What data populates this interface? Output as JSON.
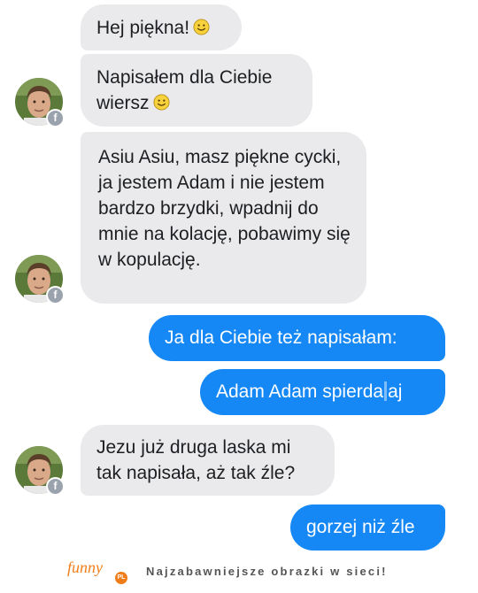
{
  "messages": [
    {
      "side": "in",
      "text": "Hej piękna!",
      "emoji": "smiley-emoji"
    },
    {
      "side": "in",
      "text": "Napisałem dla Ciebie wiersz",
      "emoji": "smiley-emoji"
    },
    {
      "side": "in",
      "text": "Asiu Asiu, masz piękne cycki, ja jestem Adam i nie jestem bardzo brzydki, wpadnij do mnie na kolację, pobawimy się w kopulację."
    },
    {
      "side": "out",
      "text": "Ja dla Ciebie też napisałam:"
    },
    {
      "side": "out",
      "text_before_cursor": "Adam Adam spierda",
      "text_after_cursor": "aj"
    },
    {
      "side": "in",
      "text": "Jezu już druga laska mi tak napisała, aż tak źle?"
    },
    {
      "side": "out",
      "text": "gorzej niż źle"
    }
  ],
  "avatar": {
    "icon": "profile-photo",
    "badge_icon": "facebook-icon",
    "badge_text": "f"
  },
  "colors": {
    "incoming_bubble": "#eaeaec",
    "outgoing_bubble": "#1688f5",
    "brand": "#f07d1a"
  },
  "footer": {
    "logo": "funny",
    "logo_badge": "PL",
    "tagline": "Najzabawniejsze obrazki w sieci!"
  }
}
